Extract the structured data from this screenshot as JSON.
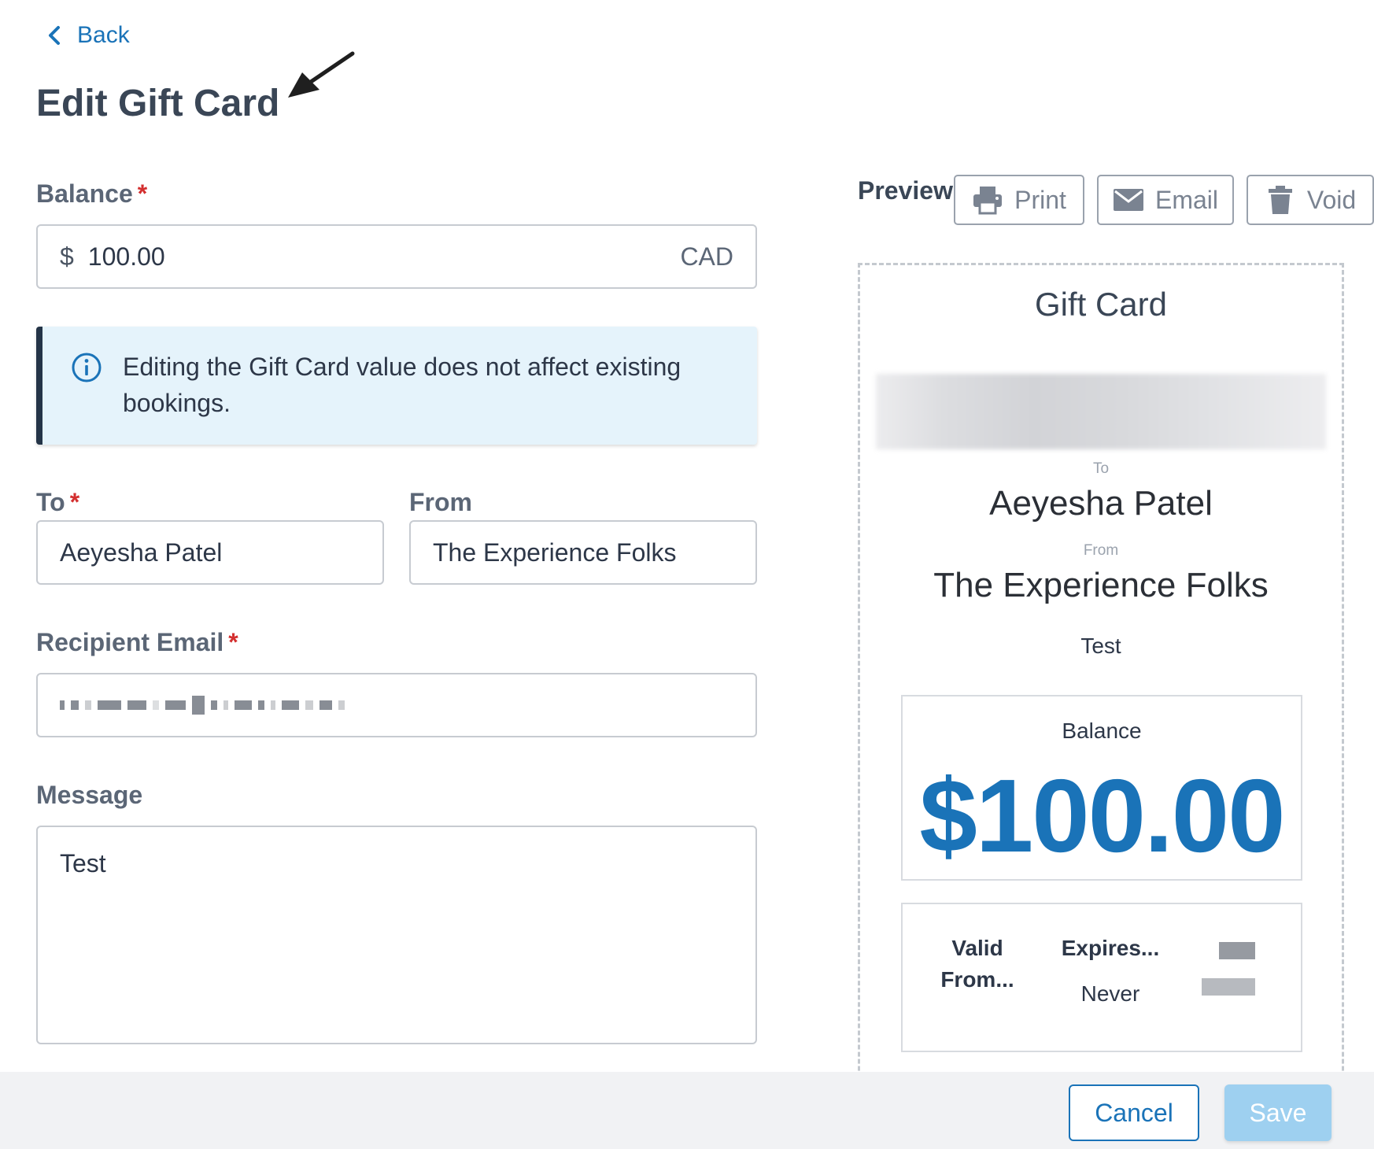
{
  "nav": {
    "back_label": "Back"
  },
  "header": {
    "title": "Edit Gift Card"
  },
  "form": {
    "balance": {
      "label": "Balance",
      "required_mark": "*",
      "currency_symbol": "$",
      "value": "100.00",
      "currency_code": "CAD"
    },
    "alert": {
      "text": "Editing the Gift Card value does not affect existing bookings."
    },
    "to": {
      "label": "To",
      "required_mark": "*",
      "value": "Aeyesha Patel"
    },
    "from": {
      "label": "From",
      "value": "The Experience Folks"
    },
    "recipient_email": {
      "label": "Recipient Email",
      "required_mark": "*"
    },
    "message": {
      "label": "Message",
      "value": "Test"
    }
  },
  "preview": {
    "label": "Preview",
    "buttons": {
      "print": "Print",
      "email": "Email",
      "void": "Void"
    },
    "card": {
      "title": "Gift Card",
      "to_label": "To",
      "to_name": "Aeyesha Patel",
      "from_label": "From",
      "from_name": "The Experience Folks",
      "message": "Test",
      "balance_label": "Balance",
      "balance_amount": "$100.00",
      "valid_from_label": "Valid From...",
      "expires_label": "Expires...",
      "expires_value": "Never"
    }
  },
  "footer": {
    "cancel_label": "Cancel",
    "save_label": "Save"
  },
  "colors": {
    "accent": "#1a73b8",
    "required": "#d32f2f",
    "alert_bg": "#e5f3fb",
    "save_disabled": "#9ed0f0"
  }
}
